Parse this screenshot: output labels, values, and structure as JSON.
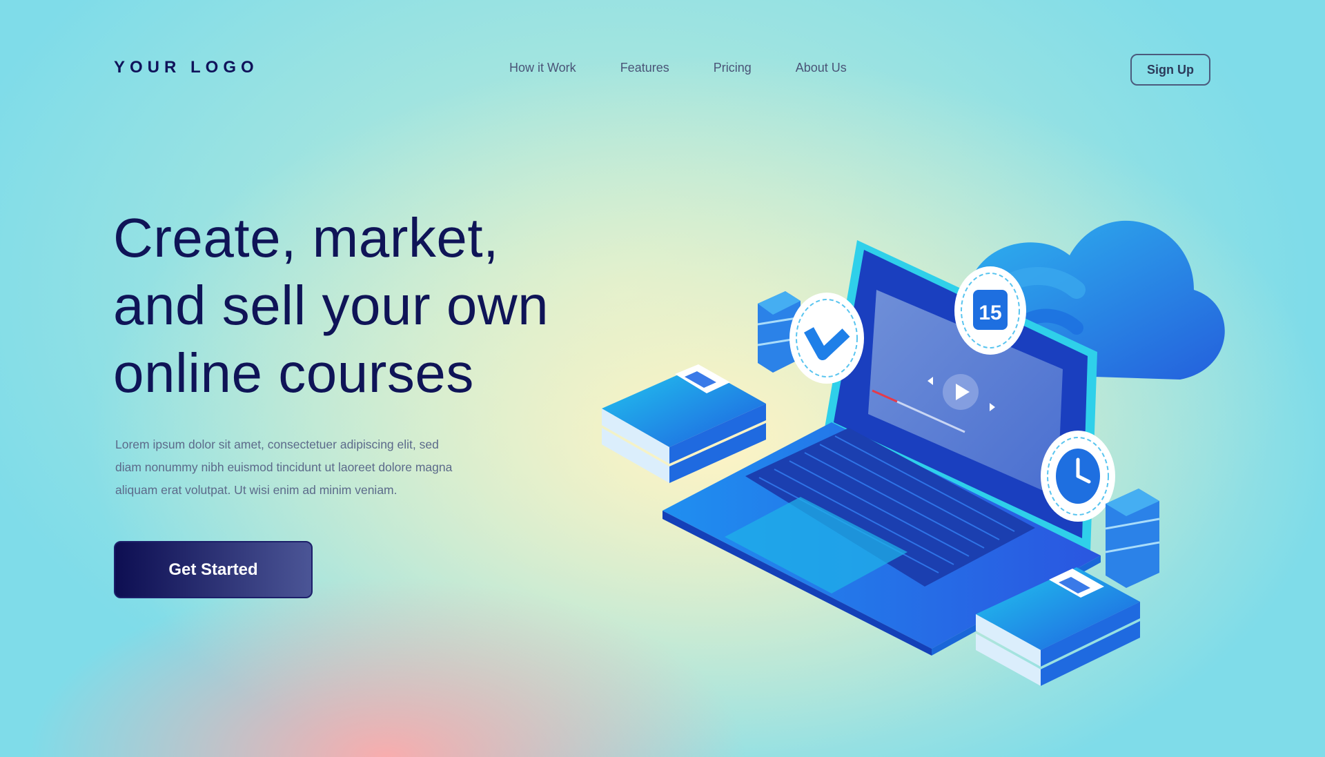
{
  "header": {
    "logo": "YOUR LOGO",
    "nav": [
      {
        "label": "How it Work"
      },
      {
        "label": "Features"
      },
      {
        "label": "Pricing"
      },
      {
        "label": "About Us"
      }
    ],
    "signup_label": "Sign Up"
  },
  "hero": {
    "headline_lines": [
      "Create, market,",
      "and sell your own",
      "online courses"
    ],
    "description_lines": [
      "Lorem ipsum dolor sit amet, consectetuer adipiscing elit, sed",
      "diam nonummy nibh euismod tincidunt ut laoreet dolore magna",
      "aliquam erat volutpat. Ut wisi enim ad minim veniam."
    ],
    "cta_label": "Get Started"
  },
  "illustration": {
    "calendar_day": "15",
    "icons": [
      "laptop-icon",
      "cloud-icon",
      "checkmark-icon",
      "calendar-icon",
      "clock-icon",
      "book-icon",
      "server-icon",
      "video-player-icon"
    ],
    "colors": {
      "primary": "#1e6fe0",
      "accent": "#22c8ee",
      "dark": "#0f1457"
    }
  }
}
